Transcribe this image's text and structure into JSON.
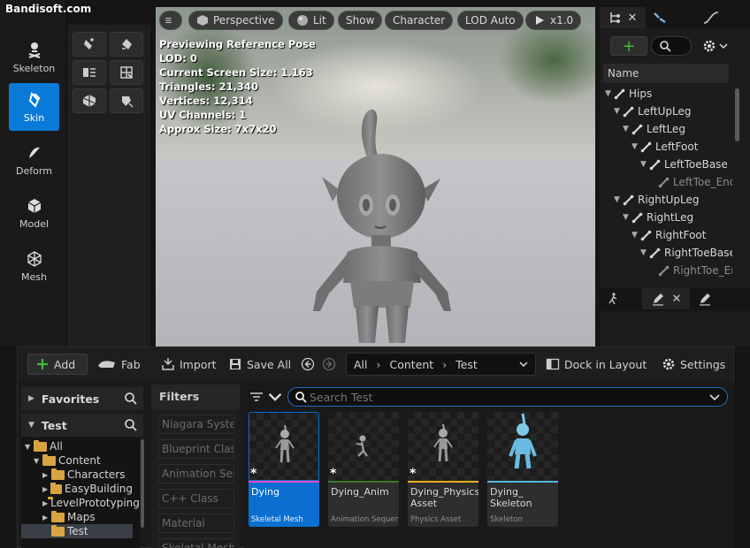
{
  "watermark": "Bandisoft.com",
  "modes": [
    {
      "label": "Skeleton",
      "icon": "skeleton-icon"
    },
    {
      "label": "Skin",
      "icon": "skin-brush-icon",
      "active": true
    },
    {
      "label": "Deform",
      "icon": "deform-icon"
    },
    {
      "label": "Model",
      "icon": "model-cube-icon"
    },
    {
      "label": "Mesh",
      "icon": "mesh-icon"
    }
  ],
  "viewport": {
    "menu_icon": "hamburger-icon",
    "perspective": "Perspective",
    "lit": "Lit",
    "show": "Show",
    "character": "Character",
    "lod": "LOD Auto",
    "speed": "x1.0",
    "stats": [
      "Previewing Reference Pose",
      "LOD: 0",
      "Current Screen Size: 1.163",
      "Triangles: 21,340",
      "Vertices: 12,314",
      "UV Channels: 1",
      "Approx Size: 7x7x20"
    ]
  },
  "skeleton_tree": {
    "column_header": "Name",
    "bones": [
      {
        "name": "Hips",
        "depth": 0
      },
      {
        "name": "LeftUpLeg",
        "depth": 1
      },
      {
        "name": "LeftLeg",
        "depth": 2
      },
      {
        "name": "LeftFoot",
        "depth": 3
      },
      {
        "name": "LeftToeBase",
        "depth": 4
      },
      {
        "name": "LeftToe_End",
        "depth": 5,
        "dim": true
      },
      {
        "name": "RightUpLeg",
        "depth": 1
      },
      {
        "name": "RightLeg",
        "depth": 2
      },
      {
        "name": "RightFoot",
        "depth": 3
      },
      {
        "name": "RightToeBase",
        "depth": 4
      },
      {
        "name": "RightToe_End",
        "depth": 5,
        "dim": true
      }
    ]
  },
  "content_browser": {
    "add": "Add",
    "fab": "Fab",
    "import": "Import",
    "save_all": "Save All",
    "breadcrumb": [
      "All",
      "Content",
      "Test"
    ],
    "dock_in_layout": "Dock in Layout",
    "settings": "Settings",
    "favorites": "Favorites",
    "test_section": "Test",
    "folders": [
      {
        "name": "All",
        "depth": 0,
        "open": true
      },
      {
        "name": "Content",
        "depth": 1,
        "open": true
      },
      {
        "name": "Characters",
        "depth": 2
      },
      {
        "name": "EasyBuilding",
        "depth": 2
      },
      {
        "name": "LevelPrototyping",
        "depth": 2
      },
      {
        "name": "Maps",
        "depth": 2
      },
      {
        "name": "Test",
        "depth": 2,
        "selected": true
      }
    ],
    "filters_title": "Filters",
    "filters": [
      "Niagara System",
      "Blueprint Class",
      "Animation Sequence",
      "C++ Class",
      "Material",
      "Skeletal Mesh"
    ],
    "search_placeholder": "Search Test",
    "assets": [
      {
        "name": "Dying",
        "type": "Skeletal Mesh",
        "color": "#e14dc8",
        "selected": true,
        "starred": true
      },
      {
        "name": "Dying_Anim",
        "type": "Animation Sequence",
        "color": "#3a7a2a",
        "starred": true
      },
      {
        "name": "Dying_Physics Asset",
        "type": "Physics Asset",
        "color": "#e8b020",
        "starred": true
      },
      {
        "name": "Dying_ Skeleton",
        "type": "Skeleton",
        "color": "#55b8e0",
        "starred": false
      }
    ]
  }
}
